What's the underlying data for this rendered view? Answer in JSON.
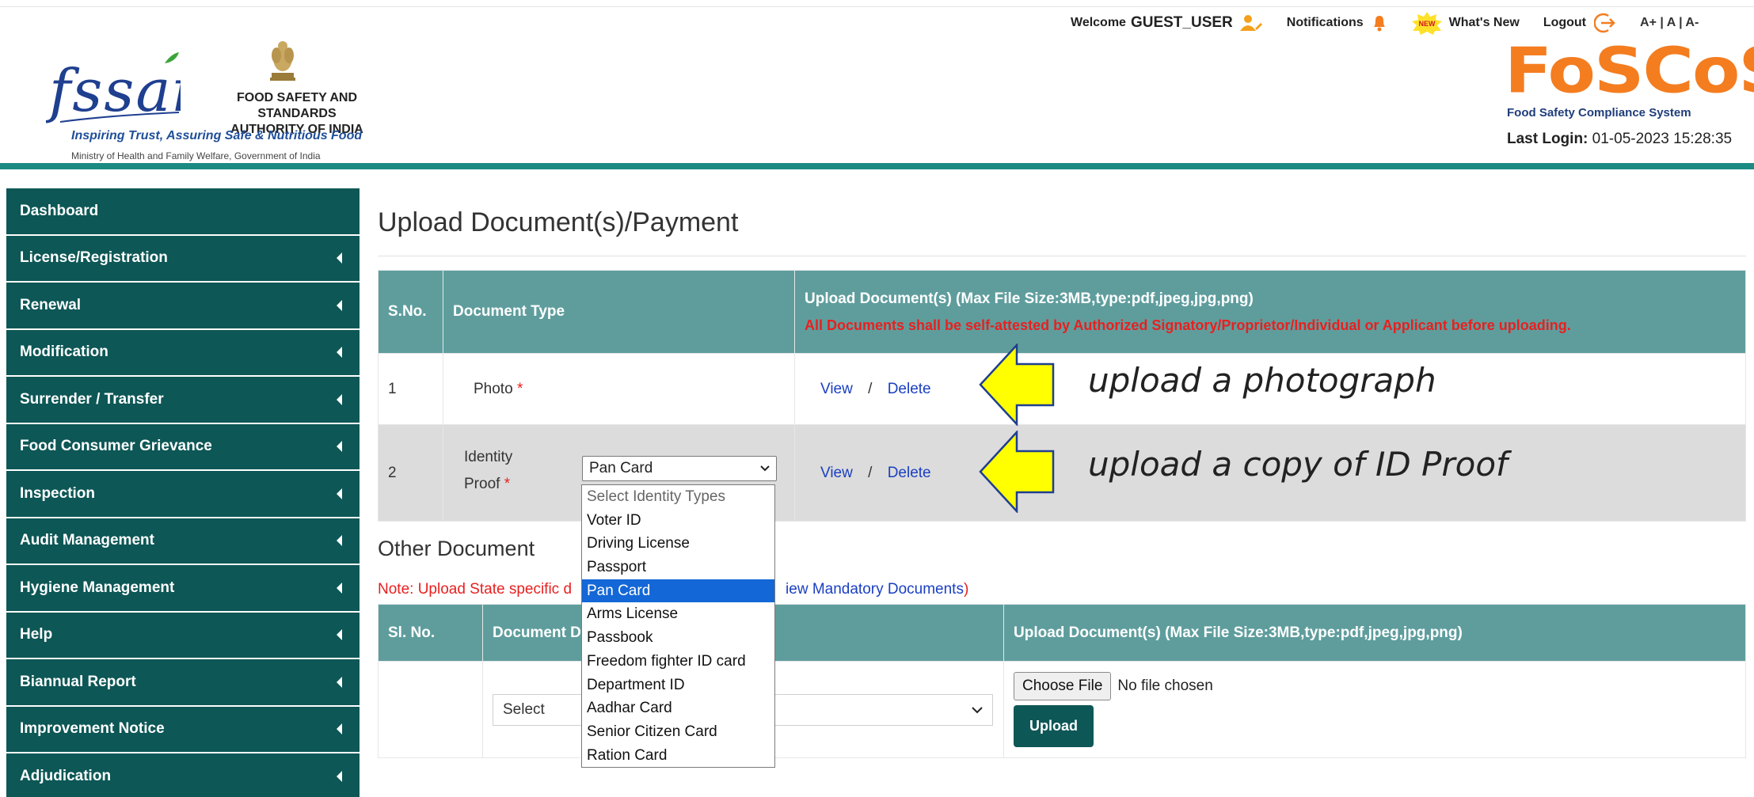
{
  "header": {
    "org_name_line1": "FOOD SAFETY AND STANDARDS",
    "org_name_line2": "AUTHORITY OF INDIA",
    "logo_text": "fssai",
    "tagline": "Inspiring Trust, Assuring Safe & Nutritious Food",
    "ministry": "Ministry of Health and Family Welfare, Government of India",
    "welcome_label": "Welcome",
    "username": "GUEST_USER",
    "notifications_label": "Notifications",
    "new_badge": "NEW",
    "whats_new_label": "What's New",
    "logout_label": "Logout",
    "font_controls": "A+ | A | A-",
    "app_name": "FoSCoS",
    "app_subtitle": "Food Safety Compliance System",
    "last_login_label": "Last Login:",
    "last_login_value": "01-05-2023 15:28:35",
    "accent_color": "#1b8a82",
    "brand_orange": "#f47d20"
  },
  "sidebar": {
    "items": [
      {
        "label": "Dashboard",
        "has_caret": false
      },
      {
        "label": "License/Registration",
        "has_caret": true
      },
      {
        "label": "Renewal",
        "has_caret": true
      },
      {
        "label": "Modification",
        "has_caret": true
      },
      {
        "label": "Surrender / Transfer",
        "has_caret": true
      },
      {
        "label": "Food Consumer Grievance",
        "has_caret": true
      },
      {
        "label": "Inspection",
        "has_caret": true
      },
      {
        "label": "Audit Management",
        "has_caret": true
      },
      {
        "label": "Hygiene Management",
        "has_caret": true
      },
      {
        "label": "Help",
        "has_caret": true
      },
      {
        "label": "Biannual Report",
        "has_caret": true
      },
      {
        "label": "Improvement Notice",
        "has_caret": true
      },
      {
        "label": "Adjudication",
        "has_caret": true
      }
    ],
    "bg_color": "#0d5756"
  },
  "main": {
    "title": "Upload Document(s)/Payment",
    "doc_table": {
      "col_sno": "S.No.",
      "col_doctype": "Document Type",
      "col_upload": "Upload Document(s) (Max File Size:3MB,type:pdf,jpeg,jpg,png)",
      "col_upload_note": "All Documents shall be self-attested by Authorized Signatory/Proprietor/Individual or Applicant before uploading.",
      "rows": [
        {
          "sno": "1",
          "doc_type": "Photo",
          "required": "*",
          "view": "View",
          "sep": "/",
          "delete": "Delete"
        },
        {
          "sno": "2",
          "doc_type_line1": "Identity",
          "doc_type_line2": "Proof",
          "required": "*",
          "selected": "Pan Card",
          "view": "View",
          "sep": "/",
          "delete": "Delete"
        }
      ]
    },
    "annotations": {
      "photo": "upload a photograph",
      "id_proof": "upload a copy of ID Proof"
    },
    "other": {
      "title": "Other Document",
      "note_prefix": "Note: Upload State specific d",
      "note_link": "iew Mandatory Documents",
      "note_suffix": ")",
      "col_slno": "Sl. No.",
      "col_doc": "Document D",
      "col_upload": "Upload Document(s) (Max File Size:3MB,type:pdf,jpeg,jpg,png)",
      "select_value": "Select",
      "choose_file": "Choose File",
      "no_file": "No file chosen",
      "upload_btn": "Upload"
    },
    "dropdown": {
      "options": [
        {
          "label": "Select Identity Types",
          "state": "placeholder"
        },
        {
          "label": "Voter ID",
          "state": ""
        },
        {
          "label": "Driving License",
          "state": ""
        },
        {
          "label": "Passport",
          "state": ""
        },
        {
          "label": "Pan Card",
          "state": "selected"
        },
        {
          "label": "Arms License",
          "state": ""
        },
        {
          "label": "Passbook",
          "state": ""
        },
        {
          "label": "Freedom fighter ID card",
          "state": ""
        },
        {
          "label": "Department ID",
          "state": ""
        },
        {
          "label": "Aadhar Card",
          "state": ""
        },
        {
          "label": "Senior Citizen Card",
          "state": ""
        },
        {
          "label": "Ration Card",
          "state": ""
        }
      ]
    },
    "table_header_color": "#5f9d9d",
    "required_color": "#e82020",
    "link_color": "#1a3fc2",
    "arrow_color": "#ffff00"
  }
}
